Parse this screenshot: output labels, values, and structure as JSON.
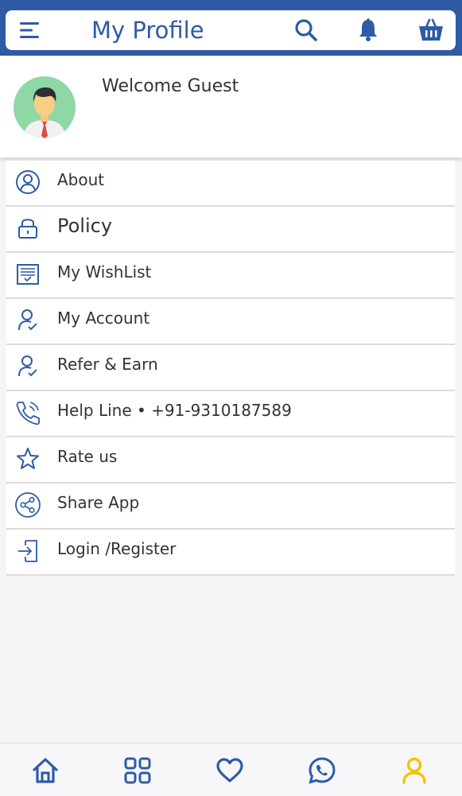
{
  "app_bar": {
    "title": "My Profile",
    "icons": [
      "menu-icon",
      "search-icon",
      "bell-icon",
      "cart-icon"
    ]
  },
  "profile": {
    "welcome_text": "Welcome Guest"
  },
  "menu": {
    "items": [
      {
        "label": "About",
        "icon": "user-circle-icon"
      },
      {
        "label": "Policy",
        "icon": "lock-icon"
      },
      {
        "label": "My WishList",
        "icon": "list-icon"
      },
      {
        "label": "My Account",
        "icon": "user-check-icon"
      },
      {
        "label": "Refer & Earn",
        "icon": "user-check-icon"
      },
      {
        "label": "Help Line • +91-9310187589",
        "icon": "phone-icon"
      },
      {
        "label": "Rate us",
        "icon": "star-icon"
      },
      {
        "label": "Share App",
        "icon": "share-icon"
      },
      {
        "label": "Login /Register",
        "icon": "login-icon"
      }
    ]
  },
  "bottom_nav": {
    "items": [
      "home-icon",
      "grid-icon",
      "heart-icon",
      "whatsapp-icon",
      "profile-icon"
    ],
    "active": "profile-icon"
  },
  "colors": {
    "primary": "#2f5ba5",
    "active_nav": "#f3c300",
    "text": "#333333"
  }
}
